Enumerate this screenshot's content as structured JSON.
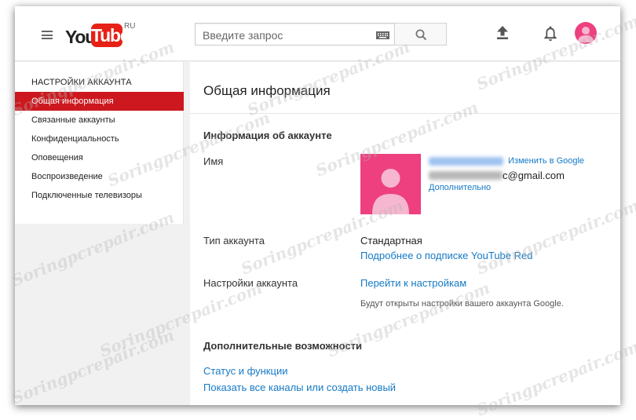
{
  "header": {
    "logo_you": "You",
    "logo_tube": "Tube",
    "logo_region": "RU",
    "search_placeholder": "Введите запрос",
    "icons": [
      "menu-icon",
      "keyboard-icon",
      "search-icon",
      "upload-icon",
      "bell-icon",
      "avatar-icon"
    ]
  },
  "sidebar": {
    "title": "НАСТРОЙКИ АККАУНТА",
    "items": [
      {
        "label": "Общая информация",
        "active": true
      },
      {
        "label": "Связанные аккаунты",
        "active": false
      },
      {
        "label": "Конфиденциальность",
        "active": false
      },
      {
        "label": "Оповещения",
        "active": false
      },
      {
        "label": "Воспроизведение",
        "active": false
      },
      {
        "label": "Подключенные телевизоры",
        "active": false
      }
    ]
  },
  "main": {
    "title": "Общая информация",
    "account_info": {
      "section_title": "Информация об аккаунте",
      "name_label": "Имя",
      "edit_link": "Изменить в Google",
      "email_visible_part": "c@gmail.com",
      "more_link": "Дополнительно",
      "account_type_label": "Тип аккаунта",
      "account_type_value": "Стандартная",
      "account_type_link": "Подробнее о подписке YouTube Red",
      "account_settings_label": "Настройки аккаунта",
      "account_settings_link": "Перейти к настройкам",
      "account_settings_note": "Будут открыты настройки вашего аккаунта Google."
    },
    "extra": {
      "section_title": "Дополнительные возможности",
      "links": [
        "Статус и функции",
        "Показать все каналы или создать новый"
      ]
    }
  },
  "watermark": "Soringpcrepair.com",
  "colors": {
    "brand_red": "#e62117",
    "active_red": "#cc181e",
    "link_blue": "#167ac6",
    "avatar_pink": "#ee3f7f"
  }
}
